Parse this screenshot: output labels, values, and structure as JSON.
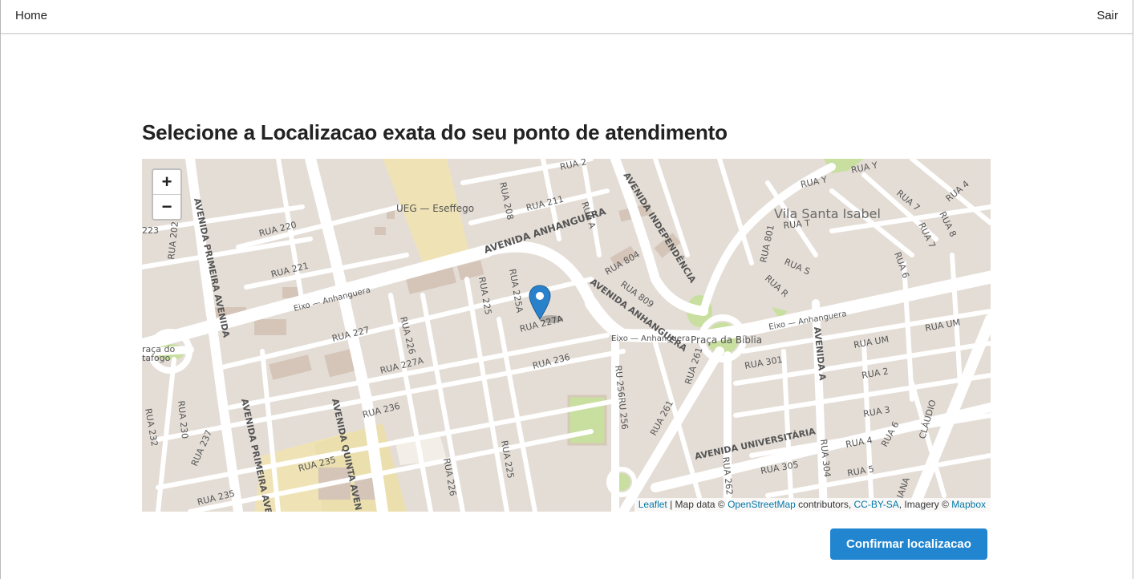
{
  "nav": {
    "home": "Home",
    "logout": "Sair"
  },
  "page": {
    "title": "Selecione a Localizacao exata do seu ponto de atendimento"
  },
  "map": {
    "zoom_in": "+",
    "zoom_out": "−",
    "attribution": {
      "leaflet": "Leaflet",
      "sep1": " | Map data © ",
      "osm": "OpenStreetMap",
      "sep2": " contributors, ",
      "license": "CC-BY-SA",
      "sep3": ", Imagery © ",
      "imagery": "Mapbox"
    },
    "marker_icon": "map-pin-icon",
    "labels": {
      "ueg": "UEG — Eseffego",
      "vila": "Vila Santa Isabel",
      "av_anhanguera": "AVENIDA ANHANGUERA",
      "av_independencia": "AVENIDA INDEPENDÊNCIA",
      "av_primeira_avenida": "AVENIDA PRIMEIRA AVENIDA",
      "av_primeira_ave": "AVENIDA PRIMEIRA AVE",
      "av_quinta_avenida": "AVENIDA QUINTA AVEN",
      "av_universitaria": "AVENIDA UNIVERSITÁRIA",
      "av_a": "AVENIDA A",
      "eixo1": "Eixo — Anhanguera",
      "eixo2": "Eixo — Anhanguera",
      "eixo3": "Eixo — Anhanguera",
      "praca_biblia": "Praça da Bíblia",
      "praca_boto": "raça do",
      "praca_boto2": "tafogo",
      "rua220": "RUA 220",
      "rua221": "RUA 221",
      "rua227": "RUA 227",
      "rua226": "RUA 226",
      "rua227a": "RUA 227A",
      "rua227a_b": "RUA 227A",
      "rua236": "RUA 236",
      "rua236b": "RUA 236",
      "rua235": "RUA 235",
      "rua235b": "RUA 235",
      "rua225": "RUA 225",
      "rua225a": "RUA 225A",
      "rua225b": "RUA 225",
      "rua226b": "RUA 226",
      "rua208": "RUA 208",
      "rua211": "RUA 211",
      "ruaa": "RUA A",
      "rua804": "RUA 804",
      "rua809": "RUA 809",
      "rua801": "RUA 801",
      "ruat": "RUA T",
      "ruas": "RUA S",
      "ruar": "RUA R",
      "ruay": "RUA Y",
      "ruay2": "RUA Y",
      "rua7": "RUA 7",
      "rua7b": "RUA 7",
      "rua8": "RUA 8",
      "rua4": "RUA 4",
      "rua6": "RUA 6",
      "rua6b": "RUA 6",
      "ruaum": "RUA UM",
      "ruaum2": "RUA UM",
      "rua2": "RUA 2",
      "rua3": "RUA 3",
      "rua4b": "RUA 4",
      "rua5": "RUA 5",
      "rua301": "RUA 301",
      "rua305": "RUA 305",
      "rua304": "RUA 304",
      "rua261": "RUA 261",
      "rua261b": "RUA 261",
      "rua262": "RUA 262",
      "rua256": "RU 256RU 256",
      "rua230": "RUA 230",
      "rua232": "RUA 232",
      "rua237": "RUA 237",
      "rua202": "RUA 202",
      "rua223": "223",
      "claudio": "CLÁUDIO",
      "iana": "IANA",
      "rua2top": "RUA 2"
    }
  },
  "actions": {
    "confirm": "Confirmar localizacao"
  },
  "colors": {
    "primary_button": "#2185d0",
    "link": "#0078a8",
    "map_land": "#e4ddd6",
    "map_road": "#ffffff",
    "map_campus": "#efe3b6",
    "map_park": "#c8dfa0",
    "marker": "#2a81cb"
  }
}
